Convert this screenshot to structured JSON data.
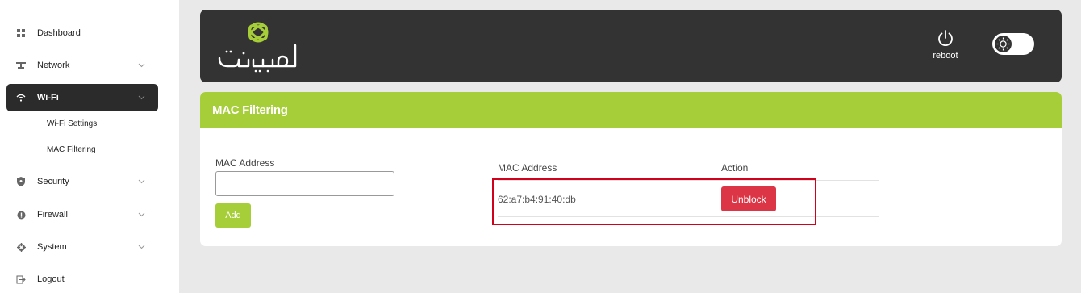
{
  "sidebar": {
    "items": [
      {
        "label": "Dashboard",
        "icon": "dashboard-grid-icon"
      },
      {
        "label": "Network",
        "icon": "network-icon"
      },
      {
        "label": "Wi-Fi",
        "icon": "wifi-icon"
      },
      {
        "label": "Security",
        "icon": "shield-icon"
      },
      {
        "label": "Firewall",
        "icon": "firewall-icon"
      },
      {
        "label": "System",
        "icon": "gear-icon"
      },
      {
        "label": "Logout",
        "icon": "logout-icon"
      }
    ],
    "wifi_sub": [
      "Wi-Fi Settings",
      "MAC Filtering"
    ],
    "active": "Wi-Fi"
  },
  "header": {
    "brand_text": "مبین نت",
    "reboot_label": "reboot",
    "theme_toggle_icon": "sun-icon"
  },
  "card": {
    "title": "MAC Filtering",
    "form": {
      "label": "MAC Address",
      "input_value": "",
      "add_label": "Add"
    },
    "table": {
      "columns": [
        "MAC Address",
        "Action"
      ],
      "rows": [
        {
          "mac": "62:a7:b4:91:40:db",
          "action": "Unblock"
        }
      ]
    }
  },
  "colors": {
    "accent_green": "#a6ce39",
    "header_dark": "#333333",
    "danger_red": "#dc3545",
    "highlight_red": "#d0021b"
  }
}
